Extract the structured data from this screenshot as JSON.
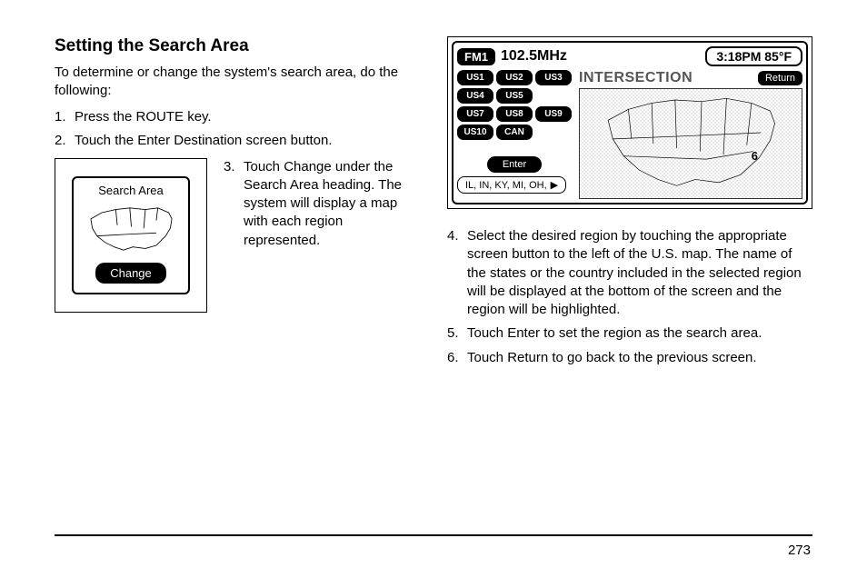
{
  "heading": "Setting the Search Area",
  "intro": "To determine or change the system's search area, do the following:",
  "step1": "Press the ROUTE key.",
  "step2": "Touch the Enter Destination screen button.",
  "step3": "Touch Change under the Search Area heading. The system will display a map with each region represented.",
  "step4": "Select the desired region by touching the appropriate screen button to the left of the U.S. map. The name of the states or the country included in the selected region will be displayed at the bottom of the screen and the region will be highlighted.",
  "step5": "Touch Enter to set the region as the search area.",
  "step6": "Touch Return to go back to the previous screen.",
  "search_box": {
    "title": "Search Area",
    "change": "Change"
  },
  "nav": {
    "band": "FM1",
    "freq": "102.5MHz",
    "status": "3:18PM 85°F",
    "intersection": "INTERSECTION",
    "return": "Return",
    "enter": "Enter",
    "states": "IL, IN, KY, MI, OH,",
    "regions": [
      "US1",
      "US2",
      "US3",
      "US4",
      "US5",
      "",
      "US7",
      "US8",
      "US9",
      "US10",
      "CAN"
    ],
    "selected_region_marker": "6"
  },
  "page": "273"
}
